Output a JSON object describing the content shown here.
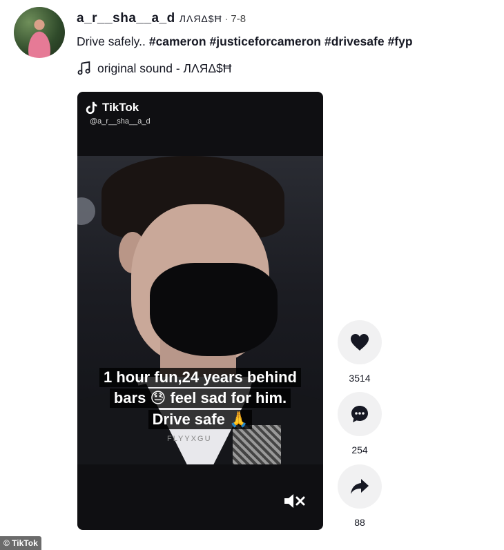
{
  "post": {
    "username": "a_r__sha__a_d",
    "nickname": "ЛΛЯΔ$Ħ",
    "separator": "·",
    "date": "7-8",
    "caption_text": "Drive safely..",
    "hashtags": [
      "#cameron",
      "#justiceforcameron",
      "#drivesafe",
      "#fyp"
    ],
    "sound_label": "original sound - ЛΛЯΔ$Ħ"
  },
  "video": {
    "watermark_brand": "TikTok",
    "watermark_user": "@a_r__sha__a_d",
    "subtitle_lines": [
      "1 hour fun,24 years behind",
      "bars 😓 feel sad for him.",
      "Drive safe 🙏"
    ],
    "overlay_text": "FLYYXGU",
    "mute_icon": "speaker-muted-icon"
  },
  "actions": {
    "likes": "3514",
    "comments": "254",
    "shares": "88"
  },
  "credit": "© TikTok",
  "colors": {
    "text": "#161823",
    "action_bg": "#f1f1f2",
    "video_bg": "#0f0f12"
  }
}
